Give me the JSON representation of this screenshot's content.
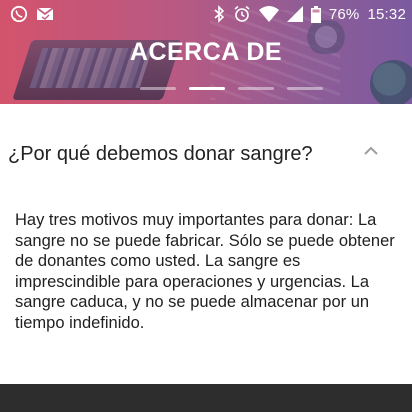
{
  "status_bar": {
    "battery": "76%",
    "time": "15:32",
    "icons": [
      "whatsapp-icon",
      "gmail-icon",
      "bluetooth-icon",
      "alarm-icon",
      "wifi-icon",
      "signal-icon",
      "battery-icon"
    ]
  },
  "header": {
    "title": "ACERCA DE",
    "pager": {
      "count": 4,
      "active_index": 1
    }
  },
  "card": {
    "question": "¿Por qué debemos donar sangre?",
    "answer": "Hay tres motivos muy importantes para donar: La sangre no se puede fabricar.  Sólo se puede obtener de donantes como usted. La sangre es imprescindible para operaciones y urgencias. La sangre caduca, y no se puede almacenar por un tiempo indefinido.",
    "expanded": true
  },
  "colors": {
    "header_start": "#d3536c",
    "header_end": "#7c5aa0",
    "card_bg": "#ffffff",
    "bottom_bg": "#2d2d2d"
  }
}
